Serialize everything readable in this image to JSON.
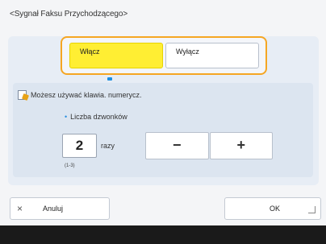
{
  "title": "<Sygnał Faksu Przychodzącego>",
  "toggle": {
    "on_label": "Włącz",
    "off_label": "Wyłącz",
    "selected": "on"
  },
  "hint": "Możesz używać klawia. numerycz.",
  "count": {
    "label": "Liczba dzwonków",
    "value": "2",
    "unit": "razy",
    "range": "(1-3)"
  },
  "stepper": {
    "minus": "−",
    "plus": "+"
  },
  "footer": {
    "cancel": "Anuluj",
    "ok": "OK"
  },
  "colors": {
    "accent": "#f5a623",
    "selected": "#ffee33",
    "indicator": "#1e8fe1"
  }
}
